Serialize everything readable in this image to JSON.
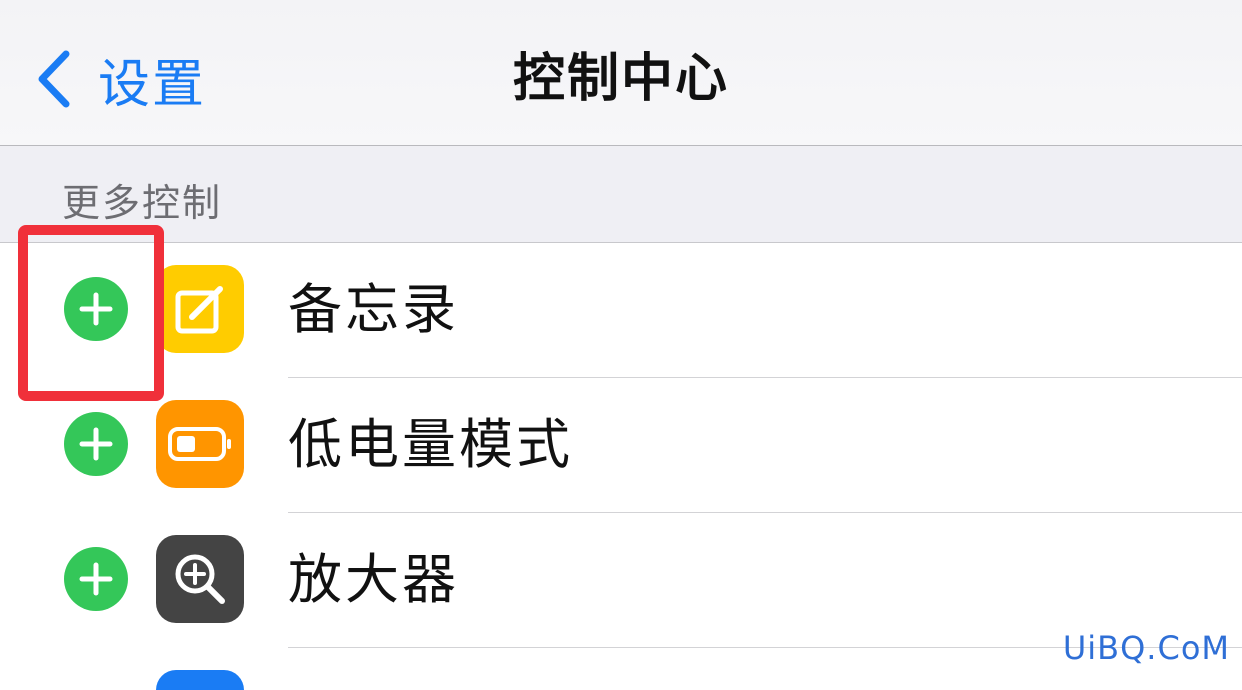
{
  "nav": {
    "back_label": "设置",
    "title": "控制中心"
  },
  "section": {
    "title": "更多控制"
  },
  "rows": [
    {
      "label": "备忘录",
      "icon": "notes-icon",
      "icon_color": "#ffcc00"
    },
    {
      "label": "低电量模式",
      "icon": "battery-icon",
      "icon_color": "#ff9500"
    },
    {
      "label": "放大器",
      "icon": "magnifier-icon",
      "icon_color": "#444444"
    }
  ],
  "colors": {
    "accent": "#1a7cf4",
    "add_button": "#34c759",
    "highlight": "#f0303a"
  },
  "watermark": "UiBQ.CoM"
}
